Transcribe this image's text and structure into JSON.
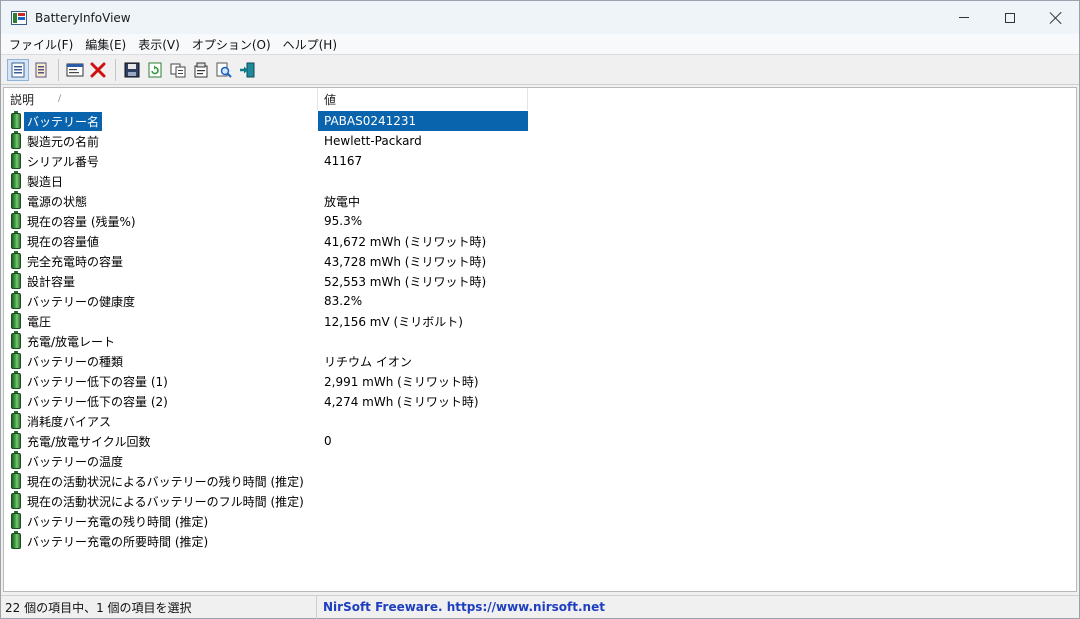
{
  "window": {
    "title": "BatteryInfoView",
    "icon": "app-icon"
  },
  "menu": [
    {
      "label": "ファイル(F)"
    },
    {
      "label": "編集(E)"
    },
    {
      "label": "表示(V)"
    },
    {
      "label": "オプション(O)"
    },
    {
      "label": "ヘルプ(H)"
    }
  ],
  "toolbar": [
    {
      "icon": "battery-info-view-icon"
    },
    {
      "icon": "battery-log-view-icon"
    },
    {
      "icon": "properties-window-icon"
    },
    {
      "icon": "delete-icon"
    },
    {
      "icon": "save-icon"
    },
    {
      "icon": "refresh-icon"
    },
    {
      "icon": "copy-icon"
    },
    {
      "icon": "html-report-icon"
    },
    {
      "icon": "find-icon"
    },
    {
      "icon": "exit-icon"
    }
  ],
  "table": {
    "columns": [
      "説明",
      "値"
    ],
    "sort_indicator": "/",
    "rows": [
      {
        "name": "バッテリー名",
        "value": "PABAS0241231",
        "selected": true
      },
      {
        "name": "製造元の名前",
        "value": "Hewlett-Packard"
      },
      {
        "name": "シリアル番号",
        "value": "41167"
      },
      {
        "name": "製造日",
        "value": ""
      },
      {
        "name": "電源の状態",
        "value": "放電中"
      },
      {
        "name": "現在の容量 (残量%)",
        "value": "95.3%"
      },
      {
        "name": "現在の容量値",
        "value": "41,672 mWh (ミリワット時)"
      },
      {
        "name": "完全充電時の容量",
        "value": "43,728 mWh (ミリワット時)"
      },
      {
        "name": "設計容量",
        "value": "52,553 mWh (ミリワット時)"
      },
      {
        "name": "バッテリーの健康度",
        "value": "83.2%"
      },
      {
        "name": "電圧",
        "value": "12,156 mV (ミリボルト)"
      },
      {
        "name": "充電/放電レート",
        "value": ""
      },
      {
        "name": "バッテリーの種類",
        "value": "リチウム イオン"
      },
      {
        "name": "バッテリー低下の容量 (1)",
        "value": "2,991 mWh (ミリワット時)"
      },
      {
        "name": "バッテリー低下の容量 (2)",
        "value": "4,274 mWh (ミリワット時)"
      },
      {
        "name": "消耗度バイアス",
        "value": ""
      },
      {
        "name": "充電/放電サイクル回数",
        "value": "0"
      },
      {
        "name": "バッテリーの温度",
        "value": ""
      },
      {
        "name": "現在の活動状況によるバッテリーの残り時間 (推定)",
        "value": ""
      },
      {
        "name": "現在の活動状況によるバッテリーのフル時間 (推定)",
        "value": ""
      },
      {
        "name": "バッテリー充電の残り時間 (推定)",
        "value": ""
      },
      {
        "name": "バッテリー充電の所要時間 (推定)",
        "value": ""
      }
    ]
  },
  "status": {
    "count_text": "22 個の項目中、1 個の項目を選択",
    "link_text": "NirSoft Freeware. https://www.nirsoft.net"
  },
  "colors": {
    "selection": "#0a64ad",
    "battery_icon": "#2e7d32",
    "link": "#1f3fbf"
  }
}
